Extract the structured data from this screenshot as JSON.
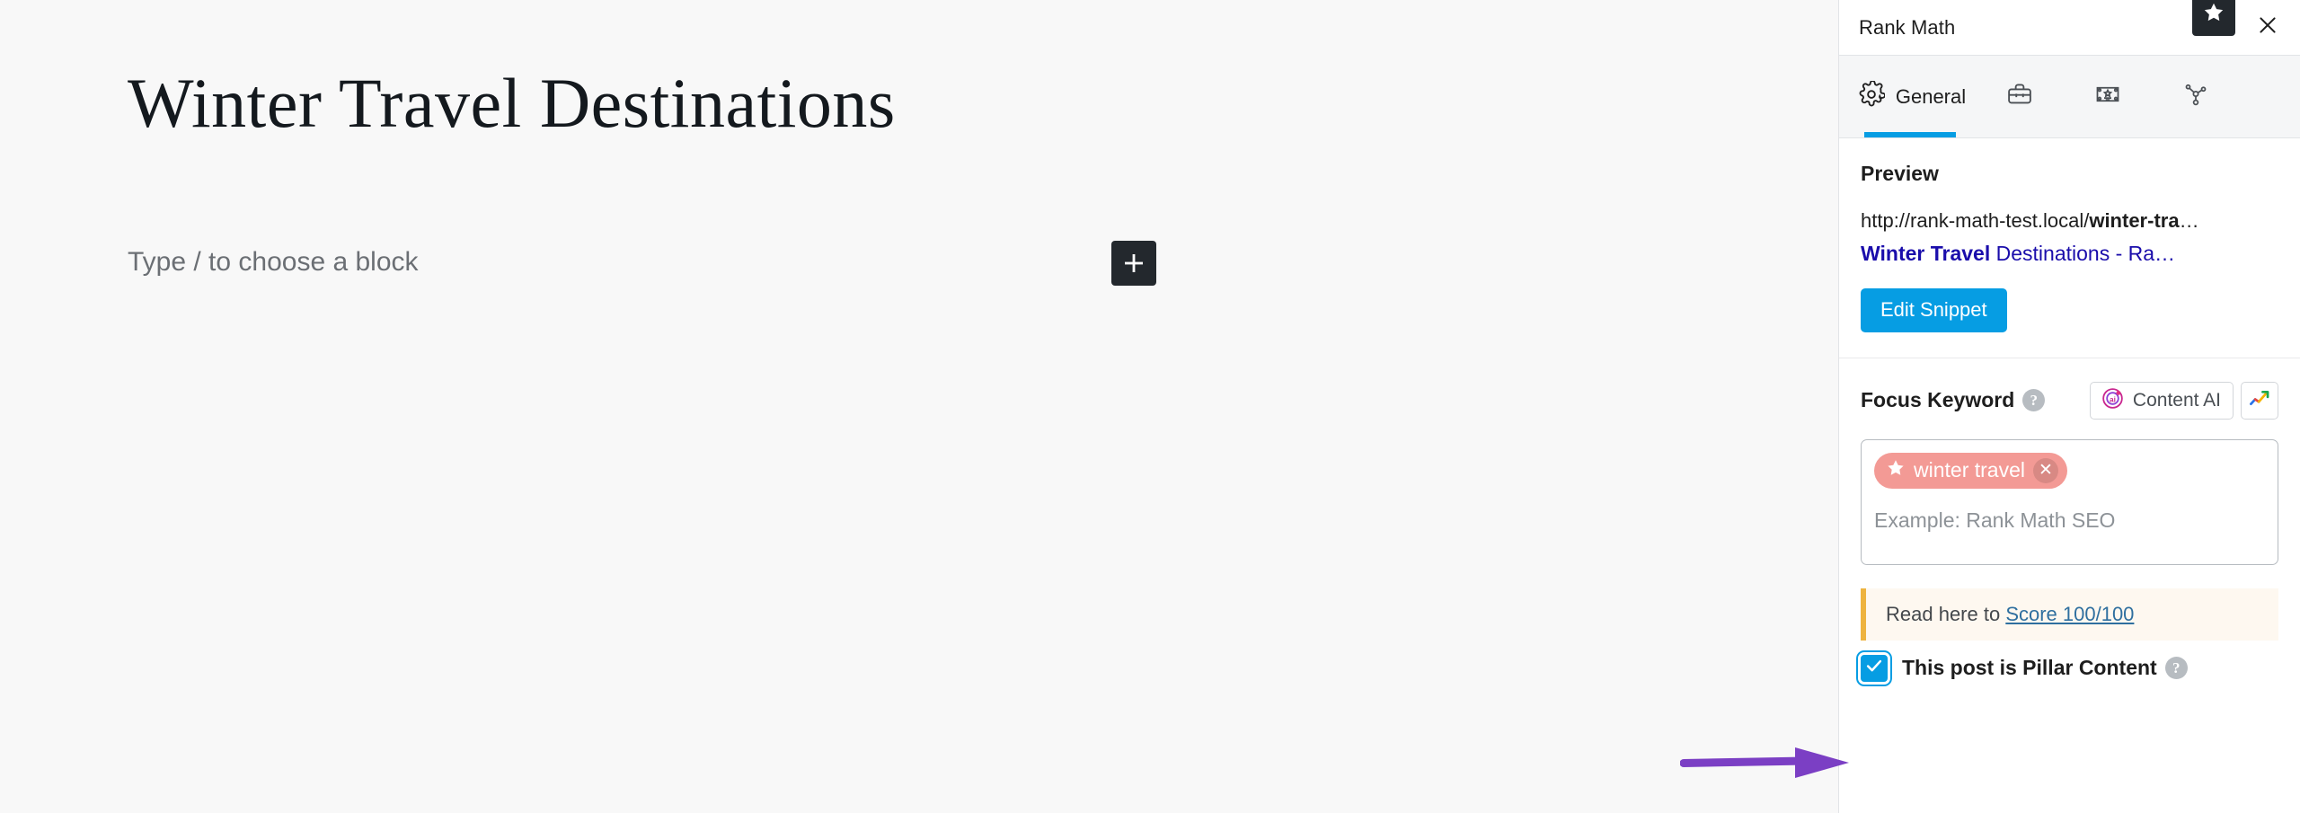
{
  "editor": {
    "post_title": "Winter Travel Destinations",
    "block_placeholder": "Type / to choose a block",
    "inserter_icon": "plus-icon"
  },
  "sidebar": {
    "header": {
      "title": "Rank Math",
      "star_badge_icon": "star-icon",
      "close_icon": "close-icon"
    },
    "tabs": [
      {
        "label": "General",
        "icon": "gear-icon",
        "active": true
      },
      {
        "label": "",
        "icon": "briefcase-icon",
        "active": false
      },
      {
        "label": "",
        "icon": "schema-certificate-icon",
        "active": false
      },
      {
        "label": "",
        "icon": "social-share-icon",
        "active": false
      }
    ],
    "preview": {
      "section_title": "Preview",
      "url_prefix": "http://rank-math-test.local/",
      "url_slug": "winter-tra",
      "url_ellipsis": "…",
      "title_highlight": "Winter Travel",
      "title_rest": " Destinations - Ra",
      "title_ellipsis": "…",
      "edit_snippet_label": "Edit Snippet"
    },
    "focus_keyword": {
      "label": "Focus Keyword",
      "help_icon": "help-icon",
      "content_ai_label": "Content AI",
      "content_ai_icon": "content-ai-icon",
      "trend_icon": "trending-chart-icon",
      "keywords": [
        {
          "text": "winter travel",
          "star_icon": "star-icon",
          "remove_icon": "close-icon"
        }
      ],
      "input_placeholder": "Example: Rank Math SEO"
    },
    "notice": {
      "text_prefix": "Read here to ",
      "link_text": "Score 100/100"
    },
    "pillar": {
      "label": "This post is Pillar Content",
      "checked": true,
      "check_icon": "checkmark-icon",
      "help_icon": "help-icon"
    }
  },
  "annotation": {
    "arrow_icon": "arrow-right-annotation",
    "color": "#7b3fc4"
  },
  "colors": {
    "accent_blue": "#069de3",
    "link_blue": "#1a0dab",
    "keyword_tag": "#f39a95",
    "notice_bg": "#fef8f0",
    "notice_border": "#eeb33f",
    "dark": "#23282d"
  }
}
